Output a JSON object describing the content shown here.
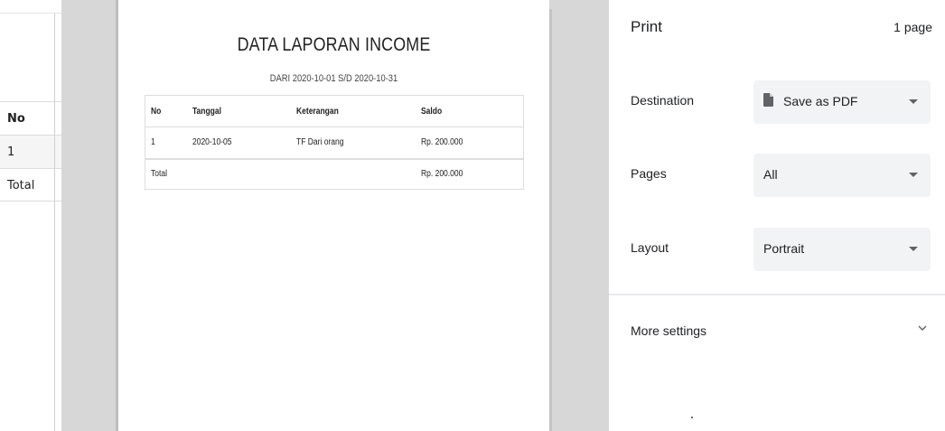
{
  "background_page": {
    "table": {
      "header": "No",
      "rows": [
        "1",
        "Total"
      ]
    }
  },
  "report": {
    "title": "DATA LAPORAN INCOME",
    "subtitle": "DARI 2020-10-01 S/D 2020-10-31",
    "columns": [
      "No",
      "Tanggal",
      "Keterangan",
      "Saldo"
    ],
    "rows": [
      {
        "no": "1",
        "tanggal": "2020-10-05",
        "keterangan": "TF Dari orang",
        "saldo": "Rp. 200.000"
      }
    ],
    "total": {
      "label": "Total",
      "saldo": "Rp. 200.000"
    }
  },
  "print_panel": {
    "title": "Print",
    "page_count": "1 page",
    "destination": {
      "label": "Destination",
      "value": "Save as PDF",
      "icon": "file-icon"
    },
    "pages": {
      "label": "Pages",
      "value": "All"
    },
    "layout": {
      "label": "Layout",
      "value": "Portrait"
    },
    "more_settings": {
      "label": "More settings",
      "icon": "chevron-down-icon"
    }
  }
}
